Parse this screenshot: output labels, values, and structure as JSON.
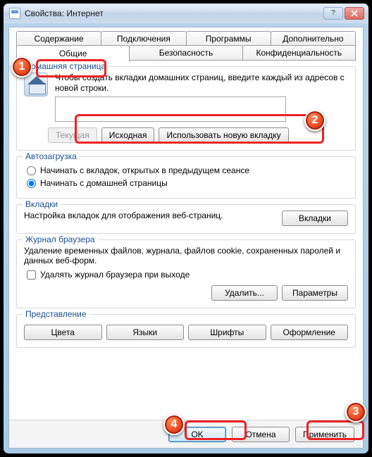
{
  "window": {
    "title": "Свойства: Интернет"
  },
  "tabs": {
    "row1": [
      "Содержание",
      "Подключения",
      "Программы",
      "Дополнительно"
    ],
    "row2": [
      "Общие",
      "Безопасность",
      "Конфиденциальность"
    ],
    "active": "Общие"
  },
  "home": {
    "legend": "Домашняя страница",
    "desc": "Чтобы создать вкладки домашних страниц, введите каждый из адресов с новой строки.",
    "url_value": "",
    "btn_current": "Текущая",
    "btn_default": "Исходная",
    "btn_newtab": "Использовать новую вкладку"
  },
  "autoload": {
    "legend": "Автозагрузка",
    "opt_tabs": "Начинать с вкладок, открытых в предыдущем сеансе",
    "opt_home": "Начинать с домашней страницы",
    "selected": "home"
  },
  "tabs_section": {
    "legend": "Вкладки",
    "desc": "Настройка вкладок для отображения веб-страниц.",
    "btn": "Вкладки"
  },
  "history": {
    "legend": "Журнал браузера",
    "desc": "Удаление временных файлов, журнала, файлов cookie, сохраненных паролей и данных веб-форм.",
    "chk_on_exit": "Удалять журнал браузера при выходе",
    "chk_on_exit_checked": false,
    "btn_delete": "Удалить...",
    "btn_params": "Параметры"
  },
  "presentation": {
    "legend": "Представление",
    "btn_colors": "Цвета",
    "btn_langs": "Языки",
    "btn_fonts": "Шрифты",
    "btn_style": "Оформление"
  },
  "footer": {
    "ok": "OK",
    "cancel": "Отмена",
    "apply": "Применить"
  },
  "annotations": {
    "1": "1",
    "2": "2",
    "3": "3",
    "4": "4"
  }
}
